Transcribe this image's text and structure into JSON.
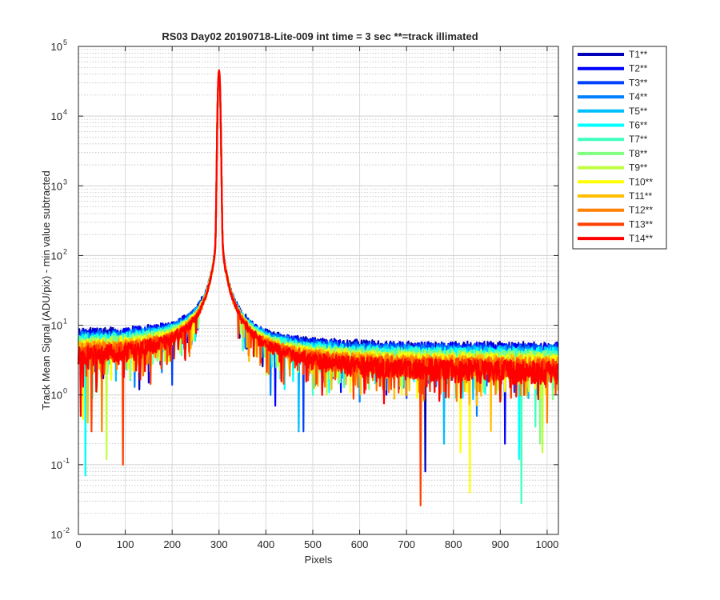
{
  "chart_data": {
    "type": "line",
    "title": "RS03 Day02 20190718-Lite-009 int time = 3 sec    **=track illimated",
    "xlabel": "Pixels",
    "ylabel": "Track Mean Signal (ADU/pix) - min value subtracted",
    "xlim": [
      0,
      1024
    ],
    "ylim": [
      0.01,
      100000
    ],
    "yscale": "log",
    "grid": true,
    "minor_grid": true,
    "legend_location": "outside-top-right",
    "x_ticks": [
      0,
      100,
      200,
      300,
      400,
      500,
      600,
      700,
      800,
      900,
      1000
    ],
    "x_tick_labels": [
      "0",
      "100",
      "200",
      "300",
      "400",
      "500",
      "600",
      "700",
      "800",
      "900",
      "1000"
    ],
    "y_ticks": [
      -2,
      -1,
      0,
      1,
      2,
      3,
      4,
      5
    ],
    "y_tick_labels": [
      {
        "base": "10",
        "exp": "-2"
      },
      {
        "base": "10",
        "exp": "-1"
      },
      {
        "base": "10",
        "exp": "0"
      },
      {
        "base": "10",
        "exp": "1"
      },
      {
        "base": "10",
        "exp": "2"
      },
      {
        "base": "10",
        "exp": "3"
      },
      {
        "base": "10",
        "exp": "4"
      },
      {
        "base": "10",
        "exp": "5"
      }
    ],
    "profile": {
      "peak_pixel": 300,
      "peak_value": 45000,
      "left_floor": 4.5,
      "right_floor": 3.0
    },
    "series": [
      {
        "name": "T1**",
        "color": "#0000B8",
        "floor_scale": 1.35,
        "dips": [
          [
            130,
            1.2
          ],
          [
            470,
            1.0
          ],
          [
            740,
            0.08
          ],
          [
            770,
            0.9
          ]
        ]
      },
      {
        "name": "T2**",
        "color": "#0000FF",
        "floor_scale": 1.3,
        "dips": [
          [
            150,
            1.5
          ],
          [
            420,
            0.7
          ],
          [
            560,
            1.1
          ],
          [
            910,
            0.2
          ]
        ]
      },
      {
        "name": "T3**",
        "color": "#0040FF",
        "floor_scale": 1.25,
        "dips": [
          [
            200,
            1.4
          ],
          [
            480,
            0.3
          ],
          [
            700,
            0.9
          ],
          [
            930,
            1.1
          ]
        ]
      },
      {
        "name": "T4**",
        "color": "#0080FF",
        "floor_scale": 1.2,
        "dips": [
          [
            120,
            1.3
          ],
          [
            410,
            1.0
          ],
          [
            600,
            0.8
          ],
          [
            850,
            0.5
          ]
        ]
      },
      {
        "name": "T5**",
        "color": "#00BFFF",
        "floor_scale": 1.15,
        "dips": [
          [
            80,
            1.6
          ],
          [
            470,
            0.3
          ],
          [
            780,
            0.2
          ],
          [
            960,
            0.9
          ]
        ]
      },
      {
        "name": "T6**",
        "color": "#00FFFF",
        "floor_scale": 1.1,
        "dips": [
          [
            15,
            0.07
          ],
          [
            440,
            1.2
          ],
          [
            820,
            0.9
          ],
          [
            940,
            0.12
          ]
        ]
      },
      {
        "name": "T7**",
        "color": "#40FFBF",
        "floor_scale": 1.05,
        "dips": [
          [
            30,
            0.9
          ],
          [
            500,
            1.0
          ],
          [
            945,
            0.028
          ],
          [
            975,
            0.35
          ]
        ]
      },
      {
        "name": "T8**",
        "color": "#80FF80",
        "floor_scale": 1.0,
        "dips": [
          [
            40,
            1.1
          ],
          [
            620,
            1.2
          ],
          [
            790,
            0.9
          ],
          [
            985,
            0.2
          ]
        ]
      },
      {
        "name": "T9**",
        "color": "#BFFF40",
        "floor_scale": 0.95,
        "dips": [
          [
            60,
            0.12
          ],
          [
            530,
            1.0
          ],
          [
            760,
            1.3
          ],
          [
            990,
            0.15
          ]
        ]
      },
      {
        "name": "T10**",
        "color": "#FFFF00",
        "floor_scale": 0.9,
        "dips": [
          [
            10,
            0.45
          ],
          [
            580,
            1.1
          ],
          [
            815,
            0.15
          ],
          [
            835,
            0.04
          ]
        ]
      },
      {
        "name": "T11**",
        "color": "#FFBF00",
        "floor_scale": 0.85,
        "dips": [
          [
            20,
            0.4
          ],
          [
            540,
            1.2
          ],
          [
            700,
            1.0
          ],
          [
            880,
            0.3
          ]
        ]
      },
      {
        "name": "T12**",
        "color": "#FF8000",
        "floor_scale": 0.8,
        "dips": [
          [
            50,
            0.3
          ],
          [
            610,
            1.3
          ],
          [
            850,
            1.0
          ],
          [
            1000,
            0.4
          ]
        ]
      },
      {
        "name": "T13**",
        "color": "#FF4000",
        "floor_scale": 0.75,
        "dips": [
          [
            95,
            0.1
          ],
          [
            28,
            0.3
          ],
          [
            650,
            1.2
          ],
          [
            730,
            0.026
          ]
        ]
      },
      {
        "name": "T14**",
        "color": "#FF0000",
        "floor_scale": 0.7,
        "dips": [
          [
            5,
            0.5
          ],
          [
            520,
            1.0
          ],
          [
            760,
            1.1
          ],
          [
            900,
            0.8
          ]
        ]
      }
    ]
  }
}
